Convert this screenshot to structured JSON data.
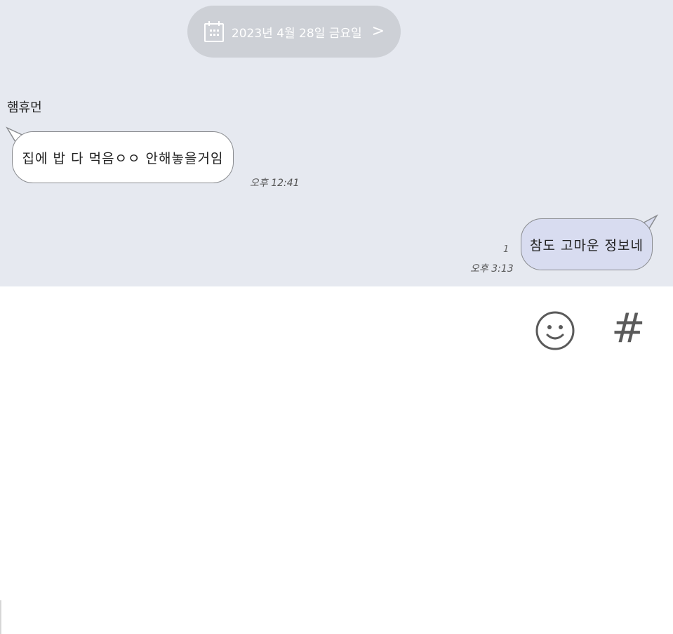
{
  "date_divider": {
    "icon": "calendar-icon",
    "text": "2023년 4월 28일 금요일",
    "chevron": "chevron-right-icon"
  },
  "messages": [
    {
      "sender": "햄휴먼",
      "text": "집에 밥 다 먹음ㅇㅇ 안해놓을거임",
      "time": "오후 12:41",
      "direction": "incoming"
    },
    {
      "text": "참도 고마운 정보네",
      "time": "오후 3:13",
      "unread": "1",
      "direction": "outgoing"
    }
  ],
  "input_bar": {
    "emoji_icon": "smiley-icon",
    "hash_label": "#"
  },
  "colors": {
    "chat_background": "#e6e9f0",
    "date_pill": "#cdd0d6",
    "incoming_bubble": "#ffffff",
    "outgoing_bubble": "#d8dcf0"
  }
}
